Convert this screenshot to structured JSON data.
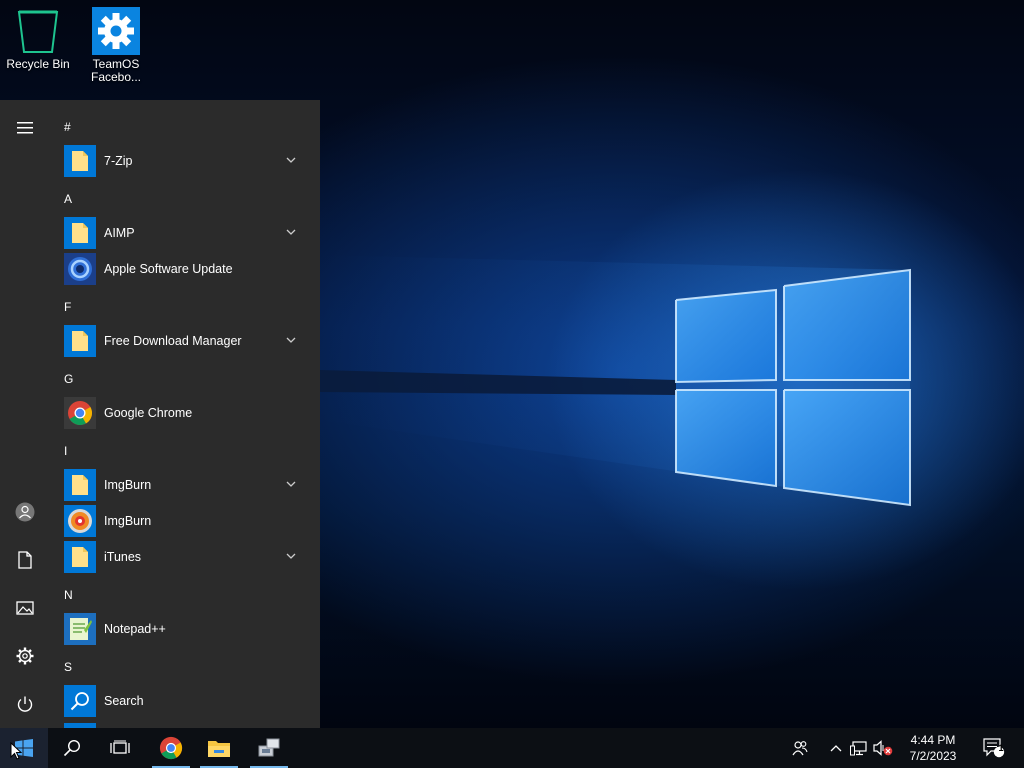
{
  "desktop": {
    "icons": [
      {
        "label": "Recycle Bin",
        "icon": "recycle-bin-icon"
      },
      {
        "label": "TeamOS Facebo...",
        "icon": "gear-icon"
      }
    ]
  },
  "start_menu": {
    "rail": {
      "menu_icon": "hamburger-icon",
      "account_icon": "user-icon",
      "documents_icon": "document-icon",
      "pictures_icon": "pictures-icon",
      "settings_icon": "gear-icon",
      "power_icon": "power-icon"
    },
    "groups": [
      {
        "letter": "#",
        "apps": [
          {
            "name": "7-Zip",
            "icon": "folder-icon",
            "expandable": true
          }
        ]
      },
      {
        "letter": "A",
        "apps": [
          {
            "name": "AIMP",
            "icon": "folder-icon",
            "expandable": true
          },
          {
            "name": "Apple Software Update",
            "icon": "apple-software-update-icon",
            "expandable": false
          }
        ]
      },
      {
        "letter": "F",
        "apps": [
          {
            "name": "Free Download Manager",
            "icon": "folder-icon",
            "expandable": true
          }
        ]
      },
      {
        "letter": "G",
        "apps": [
          {
            "name": "Google Chrome",
            "icon": "chrome-icon",
            "expandable": false
          }
        ]
      },
      {
        "letter": "I",
        "apps": [
          {
            "name": "ImgBurn",
            "icon": "folder-icon",
            "expandable": true
          },
          {
            "name": "ImgBurn",
            "icon": "imgburn-icon",
            "expandable": false
          },
          {
            "name": "iTunes",
            "icon": "folder-icon",
            "expandable": true
          }
        ]
      },
      {
        "letter": "N",
        "apps": [
          {
            "name": "Notepad++",
            "icon": "notepad-plus-plus-icon",
            "expandable": false
          }
        ]
      },
      {
        "letter": "S",
        "apps": [
          {
            "name": "Search",
            "icon": "search-icon",
            "expandable": false
          }
        ]
      }
    ]
  },
  "taskbar": {
    "pinned": [
      "start-icon",
      "search-icon",
      "task-view-icon",
      "chrome-icon",
      "file-explorer-icon",
      "network-app-icon"
    ],
    "tray": [
      "people-icon",
      "chevron-up-icon",
      "network-icon",
      "volume-muted-icon"
    ],
    "clock": {
      "time": "4:44 PM",
      "date": "7/2/2023"
    },
    "notifications": {
      "icon": "action-center-icon",
      "count": "1"
    }
  },
  "colors": {
    "accent": "#0078d7",
    "start_bg": "#2b2b2b",
    "taskbar_bg": "#0c0f14"
  }
}
